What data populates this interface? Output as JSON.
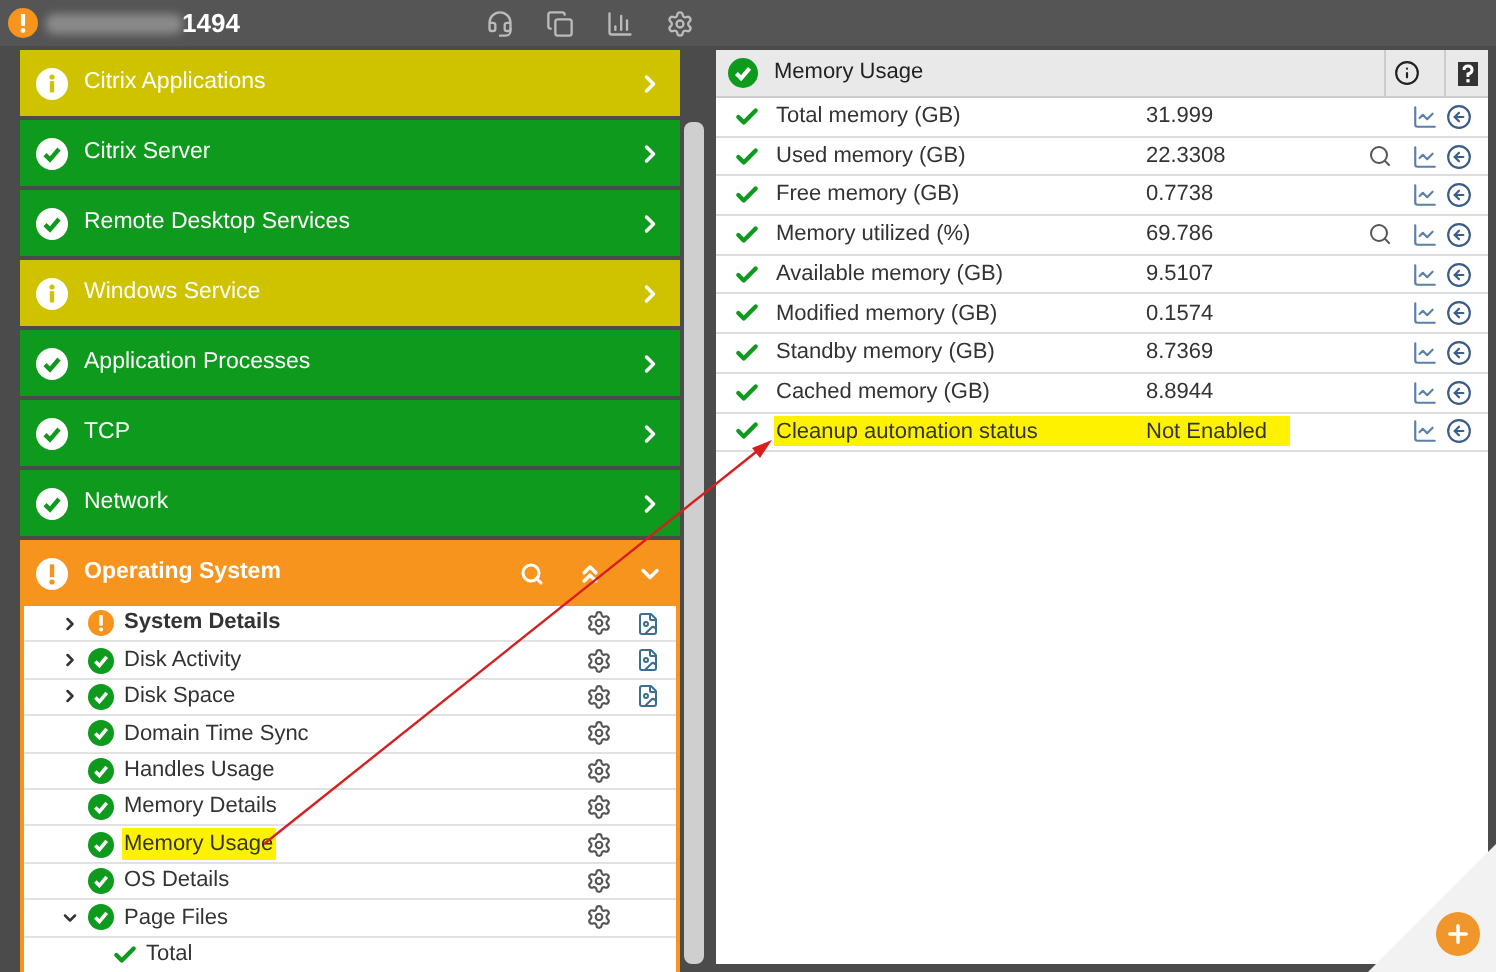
{
  "window": {
    "title": "1494",
    "kind": "warning"
  },
  "groups": [
    {
      "label": "Citrix Applications",
      "kind": "info"
    },
    {
      "label": "Citrix Server",
      "kind": "ok"
    },
    {
      "label": "Remote Desktop Services",
      "kind": "ok"
    },
    {
      "label": "Windows Service",
      "kind": "info"
    },
    {
      "label": "Application Processes",
      "kind": "ok"
    },
    {
      "label": "TCP",
      "kind": "ok"
    },
    {
      "label": "Network",
      "kind": "ok"
    }
  ],
  "open_group": {
    "label": "Operating System",
    "kind": "warning",
    "expanded": true,
    "items": [
      {
        "label": "System Details",
        "kind": "warning",
        "expandable": true,
        "expanded": false,
        "bold": true,
        "report": true,
        "highlighted": false
      },
      {
        "label": "Disk Activity",
        "kind": "ok",
        "expandable": true,
        "expanded": false,
        "bold": false,
        "report": true,
        "highlighted": false
      },
      {
        "label": "Disk Space",
        "kind": "ok",
        "expandable": true,
        "expanded": false,
        "bold": false,
        "report": true,
        "highlighted": false
      },
      {
        "label": "Domain Time Sync",
        "kind": "ok",
        "expandable": false,
        "bold": false,
        "report": false,
        "highlighted": false
      },
      {
        "label": "Handles Usage",
        "kind": "ok",
        "expandable": false,
        "bold": false,
        "report": false,
        "highlighted": false
      },
      {
        "label": "Memory Details",
        "kind": "ok",
        "expandable": false,
        "bold": false,
        "report": false,
        "highlighted": false
      },
      {
        "label": "Memory Usage",
        "kind": "ok",
        "expandable": false,
        "bold": false,
        "report": false,
        "highlighted": true
      },
      {
        "label": "OS Details",
        "kind": "ok",
        "expandable": false,
        "bold": false,
        "report": false,
        "highlighted": false
      },
      {
        "label": "Page Files",
        "kind": "ok",
        "expandable": true,
        "expanded": true,
        "bold": false,
        "report": false,
        "highlighted": false,
        "children": [
          {
            "label": "Total"
          }
        ]
      }
    ]
  },
  "detail": {
    "title": "Memory Usage",
    "kind": "ok",
    "rows": [
      {
        "name": "Total memory (GB)",
        "value": "31.999",
        "search": false,
        "highlighted": false
      },
      {
        "name": "Used memory (GB)",
        "value": "22.3308",
        "search": true,
        "highlighted": false
      },
      {
        "name": "Free memory (GB)",
        "value": "0.7738",
        "search": false,
        "highlighted": false
      },
      {
        "name": "Memory utilized (%)",
        "value": "69.786",
        "search": true,
        "highlighted": false
      },
      {
        "name": "Available memory (GB)",
        "value": "9.5107",
        "search": false,
        "highlighted": false
      },
      {
        "name": "Modified memory (GB)",
        "value": "0.1574",
        "search": false,
        "highlighted": false
      },
      {
        "name": "Standby memory (GB)",
        "value": "8.7369",
        "search": false,
        "highlighted": false
      },
      {
        "name": "Cached memory (GB)",
        "value": "8.8944",
        "search": false,
        "highlighted": false
      },
      {
        "name": "Cleanup automation status",
        "value": "Not Enabled",
        "search": false,
        "highlighted": true
      }
    ]
  }
}
